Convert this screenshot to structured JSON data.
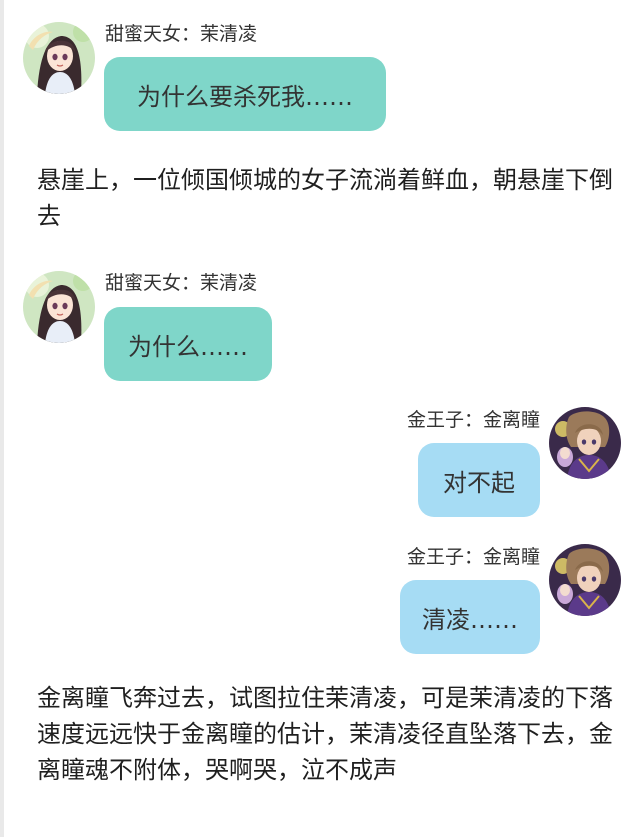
{
  "colors": {
    "heroine_bubble": "#7fd6c9",
    "prince_bubble": "#a6dcf4",
    "text": "#222222",
    "background": "#ffffff"
  },
  "characters": {
    "heroine": {
      "sender_label": "甜蜜天女：茉清凌",
      "avatar_icon": "anime-girl-avatar-icon"
    },
    "prince": {
      "sender_label": "金王子：金离瞳",
      "avatar_icon": "anime-boy-avatar-icon"
    }
  },
  "feed": {
    "msg1": {
      "speaker": "heroine",
      "text": "为什么要杀死我……"
    },
    "narration1": "悬崖上，一位倾国倾城的女子流淌着鲜血，朝悬崖下倒去",
    "msg2": {
      "speaker": "heroine",
      "text": "为什么……"
    },
    "msg3": {
      "speaker": "prince",
      "text": "对不起"
    },
    "msg4": {
      "speaker": "prince",
      "text": "清凌……"
    },
    "narration2": "金离瞳飞奔过去，试图拉住茉清凌，可是茉清凌的下落速度远远快于金离瞳的估计，茉清凌径直坠落下去，金离瞳魂不附体，哭啊哭，泣不成声"
  }
}
